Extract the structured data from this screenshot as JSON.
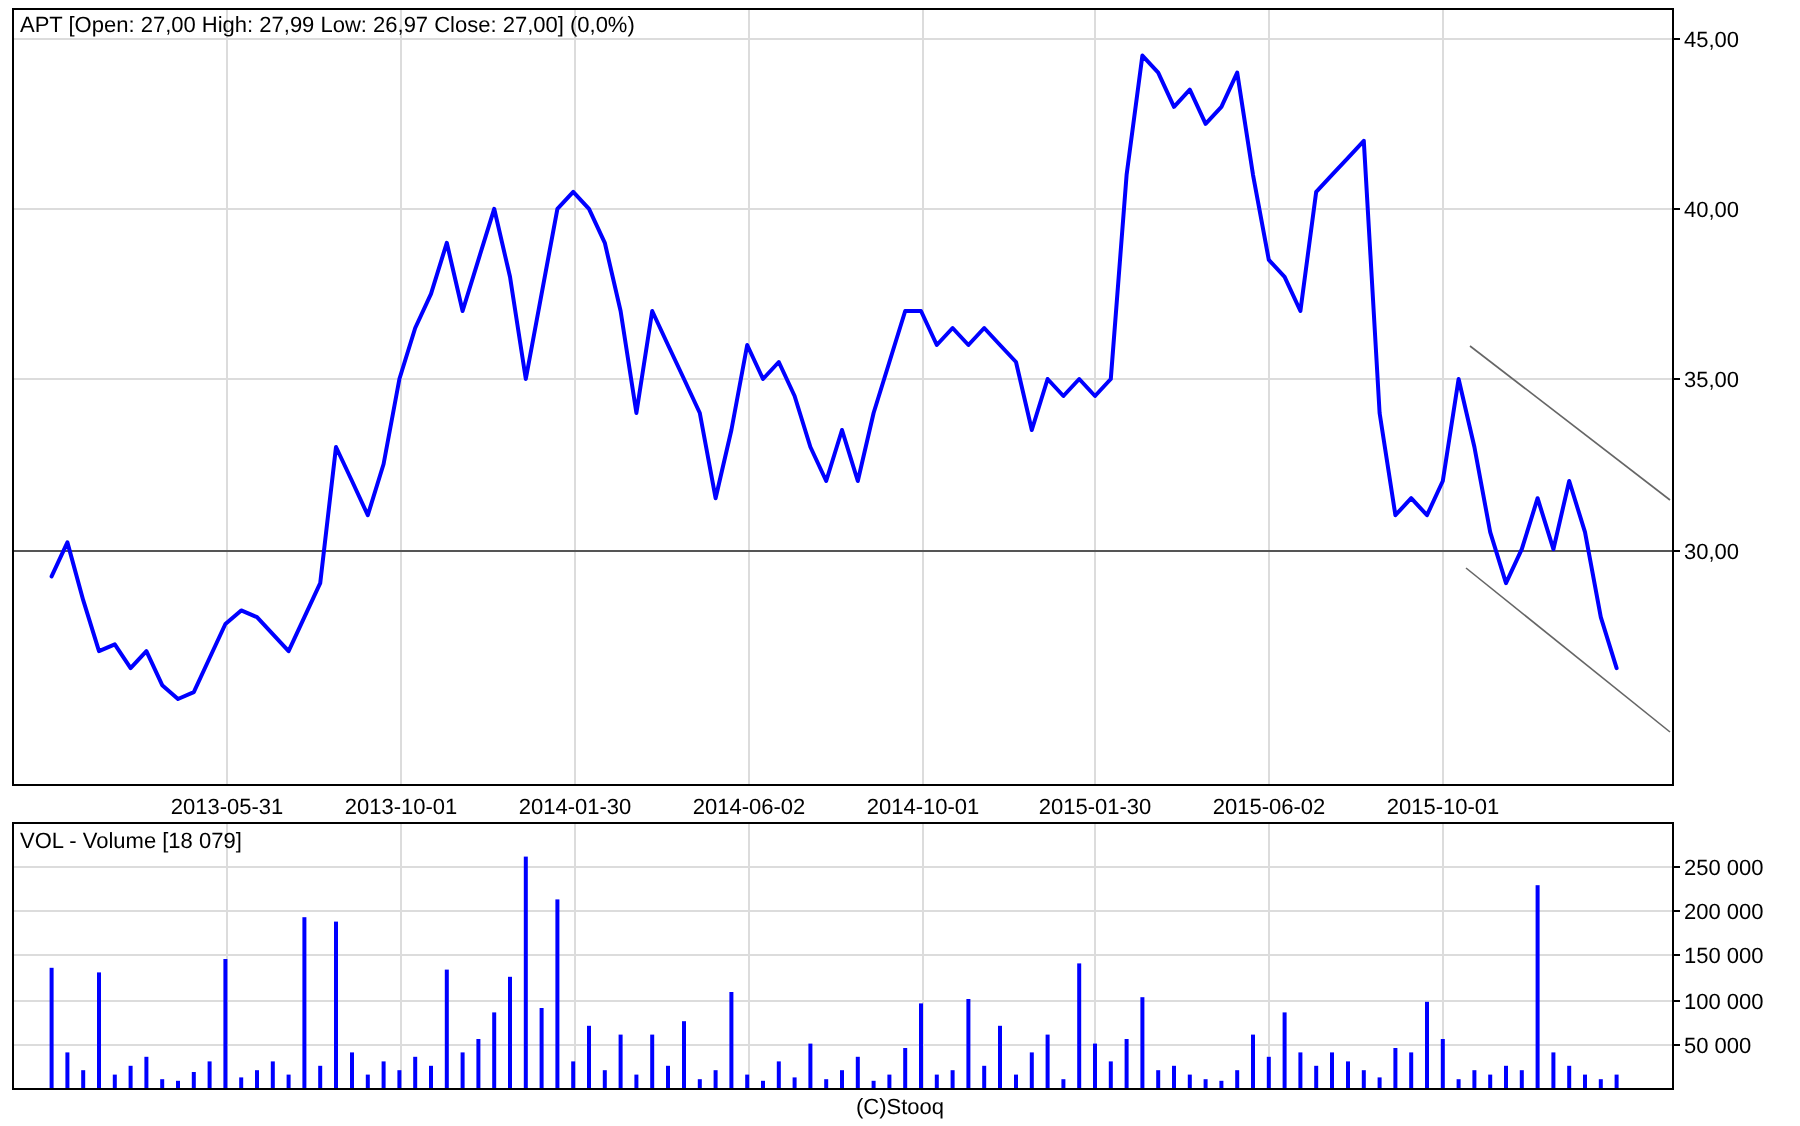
{
  "price_panel": {
    "title": "APT [Open: 27,00  High: 27,99  Low: 26,97  Close: 27,00] (0,0%)",
    "chart_data": {
      "type": "line",
      "grid": true,
      "categories": [
        null,
        null,
        null,
        null,
        null,
        null,
        null,
        null,
        null,
        null,
        null,
        null,
        null,
        "2013-05-31",
        null,
        null,
        null,
        null,
        null,
        null,
        null,
        null,
        null,
        null,
        "2013-10-01",
        null,
        null,
        null,
        null,
        null,
        null,
        null,
        null,
        null,
        null,
        "2014-01-30",
        null,
        null,
        null,
        null,
        null,
        null,
        null,
        null,
        null,
        null,
        "2014-06-02",
        null,
        null,
        null,
        null,
        null,
        null,
        null,
        null,
        null,
        null,
        "2014-10-01",
        null,
        null,
        null,
        null,
        null,
        null,
        null,
        null,
        null,
        null,
        "2015-01-30",
        null,
        null,
        null,
        null,
        null,
        null,
        null,
        null,
        null,
        null,
        "2015-06-02",
        null,
        null,
        null,
        null,
        null,
        null,
        null,
        null,
        null,
        null,
        "2015-10-01",
        null,
        null,
        null,
        null,
        null,
        null,
        null,
        null,
        null,
        null,
        null,
        null,
        null,
        null
      ],
      "series": [
        {
          "color": "#0000ff",
          "values": [
            null,
            null,
            29.2,
            30.2,
            28.5,
            27.0,
            27.2,
            26.5,
            27.0,
            26.0,
            25.6,
            25.8,
            26.8,
            27.8,
            28.2,
            28.0,
            27.5,
            27.0,
            28.0,
            29.0,
            33.0,
            32.0,
            31.0,
            32.5,
            35.0,
            36.5,
            37.5,
            39.0,
            37.0,
            38.5,
            40.0,
            38.0,
            35.0,
            37.5,
            40.0,
            40.5,
            40.0,
            39.0,
            37.0,
            34.0,
            37.0,
            36.0,
            35.0,
            34.0,
            31.5,
            33.5,
            36.0,
            35.0,
            35.5,
            34.5,
            33.0,
            32.0,
            33.5,
            32.0,
            34.0,
            35.5,
            37.0,
            37.0,
            36.0,
            36.5,
            36.0,
            36.5,
            36.0,
            35.5,
            33.5,
            35.0,
            34.5,
            35.0,
            34.5,
            35.0,
            41.0,
            44.5,
            44.0,
            43.0,
            43.5,
            42.5,
            43.0,
            44.0,
            41.0,
            38.5,
            38.0,
            37.0,
            40.5,
            41.0,
            41.5,
            42.0,
            34.0,
            31.0,
            31.5,
            31.0,
            32.0,
            35.0,
            33.0,
            30.5,
            29.0,
            30.0,
            31.5,
            30.0,
            32.0,
            30.5,
            28.0,
            26.5,
            null,
            null,
            null
          ]
        }
      ],
      "ylim": [
        23.1,
        45.9
      ],
      "yticks": [
        {
          "value": 30,
          "label": "30,00"
        },
        {
          "value": 35,
          "label": "35,00"
        },
        {
          "value": 40,
          "label": "40,00"
        },
        {
          "value": 45,
          "label": "45,00"
        }
      ],
      "ref_lines": [
        {
          "axis": "y",
          "value": 30
        }
      ]
    }
  },
  "volume_panel": {
    "title": "VOL - Volume [18 079]",
    "chart_data": {
      "type": "bar",
      "grid": true,
      "series": [
        {
          "color": "#0000ff",
          "values": [
            null,
            null,
            135000,
            40000,
            20000,
            130000,
            15000,
            25000,
            35000,
            10000,
            8000,
            18000,
            30000,
            145000,
            12000,
            20000,
            30000,
            15000,
            192000,
            25000,
            187000,
            40000,
            15000,
            30000,
            20000,
            35000,
            25000,
            133000,
            40000,
            55000,
            85000,
            125000,
            260000,
            90000,
            212000,
            30000,
            70000,
            20000,
            60000,
            15000,
            60000,
            25000,
            75000,
            10000,
            20000,
            108000,
            15000,
            8000,
            30000,
            12000,
            50000,
            10000,
            20000,
            35000,
            8000,
            15000,
            45000,
            95000,
            15000,
            20000,
            100000,
            25000,
            70000,
            15000,
            40000,
            60000,
            10000,
            140000,
            50000,
            30000,
            55000,
            102000,
            20000,
            25000,
            15000,
            10000,
            8000,
            20000,
            60000,
            35000,
            85000,
            40000,
            25000,
            40000,
            30000,
            20000,
            12000,
            45000,
            40000,
            97000,
            55000,
            10000,
            20000,
            15000,
            25000,
            20000,
            228000,
            40000,
            25000,
            15000,
            10000,
            15000,
            null,
            null,
            null
          ]
        }
      ],
      "ylim": [
        0,
        299000
      ],
      "yticks": [
        {
          "value": 50000,
          "label": "50 000"
        },
        {
          "value": 100000,
          "label": "100 000"
        },
        {
          "value": 150000,
          "label": "150 000"
        },
        {
          "value": 200000,
          "label": "200 000"
        },
        {
          "value": 250000,
          "label": "250 000"
        }
      ]
    }
  },
  "footer": "(C)Stooq"
}
